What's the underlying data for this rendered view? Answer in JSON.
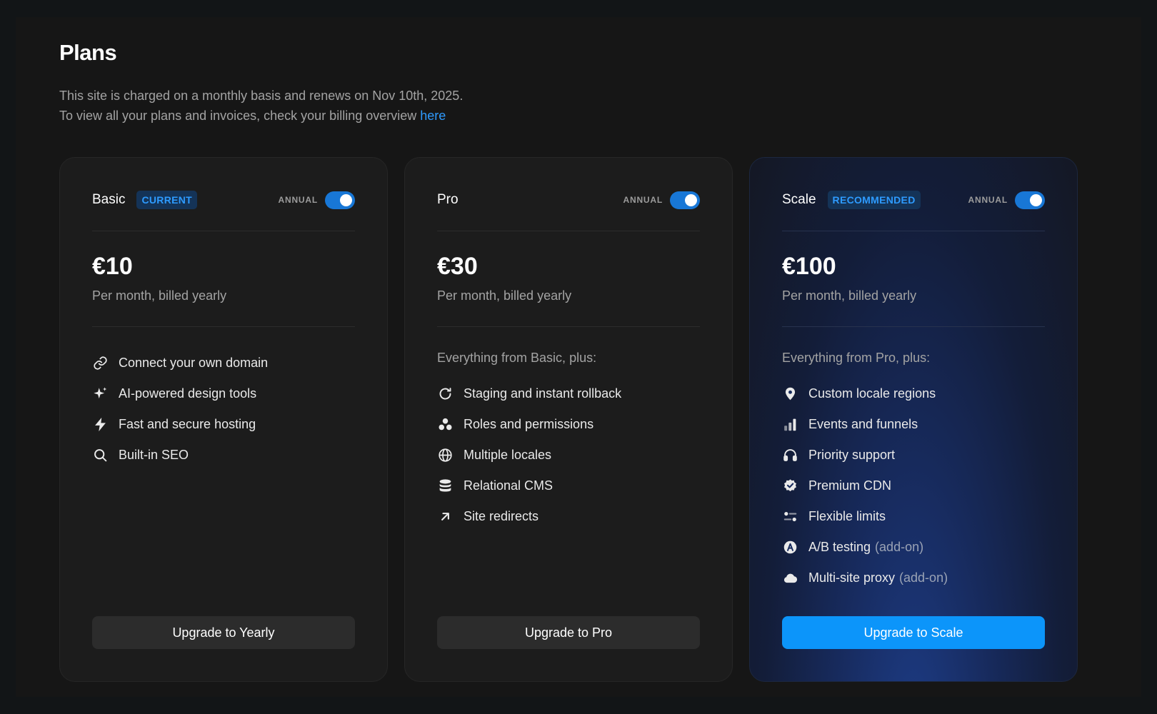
{
  "page": {
    "title": "Plans",
    "description_line1": "This site is charged on a monthly basis and renews on Nov 10th, 2025.",
    "description_line2": "To view all your plans and invoices, check your billing overview",
    "billing_link": "here"
  },
  "colors": {
    "accent": "#0c95fa",
    "badge_text": "#2e9bff",
    "card_bg": "#1c1c1c",
    "scale_card_bg": "#172a5c"
  },
  "plans": [
    {
      "name": "Basic",
      "badge": "CURRENT",
      "annual_label": "ANNUAL",
      "annual_on": true,
      "price": "€10",
      "billing": "Per month, billed yearly",
      "features_intro": "",
      "features": [
        {
          "icon": "link-icon",
          "label": "Connect your own domain"
        },
        {
          "icon": "sparkle-icon",
          "label": "AI-powered design tools"
        },
        {
          "icon": "lightning-icon",
          "label": "Fast and secure hosting"
        },
        {
          "icon": "search-icon",
          "label": "Built-in SEO"
        }
      ],
      "cta": "Upgrade to Yearly"
    },
    {
      "name": "Pro",
      "badge": "",
      "annual_label": "ANNUAL",
      "annual_on": true,
      "price": "€30",
      "billing": "Per month, billed yearly",
      "features_intro": "Everything from Basic, plus:",
      "features": [
        {
          "icon": "refresh-icon",
          "label": "Staging and instant rollback"
        },
        {
          "icon": "users-icon",
          "label": "Roles and permissions"
        },
        {
          "icon": "globe-icon",
          "label": "Multiple locales"
        },
        {
          "icon": "database-icon",
          "label": "Relational CMS"
        },
        {
          "icon": "arrow-up-right-icon",
          "label": "Site redirects"
        }
      ],
      "cta": "Upgrade to Pro"
    },
    {
      "name": "Scale",
      "badge": "RECOMMENDED",
      "annual_label": "ANNUAL",
      "annual_on": true,
      "price": "€100",
      "billing": "Per month, billed yearly",
      "features_intro": "Everything from Pro, plus:",
      "features": [
        {
          "icon": "map-pin-icon",
          "label": "Custom locale regions",
          "addon": ""
        },
        {
          "icon": "bar-chart-icon",
          "label": "Events and funnels",
          "addon": ""
        },
        {
          "icon": "headphones-icon",
          "label": "Priority support",
          "addon": ""
        },
        {
          "icon": "verified-badge-icon",
          "label": "Premium CDN",
          "addon": ""
        },
        {
          "icon": "sliders-icon",
          "label": "Flexible limits",
          "addon": ""
        },
        {
          "icon": "ab-test-icon",
          "label": "A/B testing",
          "addon": "(add-on)"
        },
        {
          "icon": "cloud-icon",
          "label": "Multi-site proxy",
          "addon": "(add-on)"
        }
      ],
      "cta": "Upgrade to Scale"
    }
  ]
}
